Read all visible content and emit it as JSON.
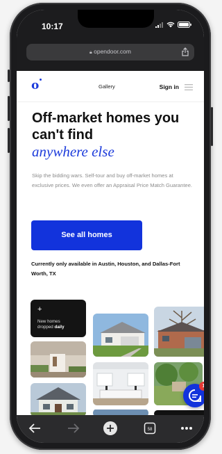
{
  "status": {
    "time": "10:17"
  },
  "browser": {
    "url": "opendoor.com"
  },
  "header": {
    "logo": "o",
    "gallery": "Gallery",
    "sign_in": "Sign in"
  },
  "hero": {
    "headline": "Off-market homes you can't find",
    "headline_italic": "anywhere else",
    "body": "Skip the bidding wars. Self-tour and buy off-market homes at exclusive prices. We even offer an Appraisal Price Match Guarantee.",
    "cta": "See all homes",
    "availability": "Currently only available in Austin, Houston, and Dallas-Fort Worth, TX"
  },
  "gallery_tile": {
    "plus": "+",
    "line1": "New homes",
    "line2": "dropped",
    "line3": "daily"
  },
  "chat": {
    "badge": "1"
  },
  "colors": {
    "brand": "#1233dc",
    "badge": "#e53935"
  }
}
